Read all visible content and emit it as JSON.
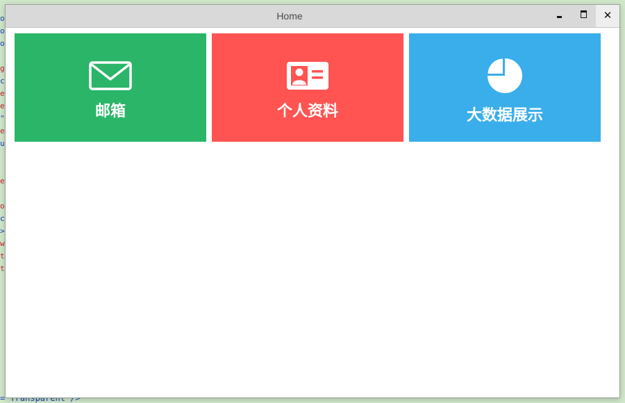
{
  "window": {
    "title": "Home",
    "close_glyph": "✕"
  },
  "tiles": [
    {
      "label": "邮箱",
      "icon": "envelope-icon",
      "color": "#2bb568"
    },
    {
      "label": "个人资料",
      "icon": "id-card-icon",
      "color": "#ff5451"
    },
    {
      "label": "大数据展示",
      "icon": "pie-chart-icon",
      "color": "#3aaeea"
    }
  ],
  "background_code": {
    "bottom_line": "=\"Transparent\"/>"
  }
}
